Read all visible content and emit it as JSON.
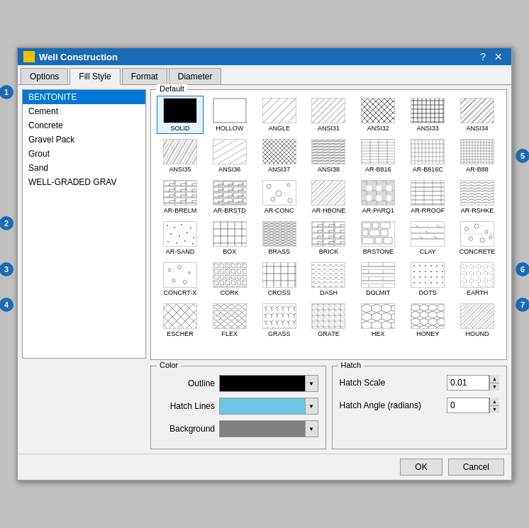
{
  "dialog": {
    "title": "Well Construction",
    "help_label": "?",
    "close_label": "✕"
  },
  "tabs": [
    {
      "label": "Options",
      "active": false
    },
    {
      "label": "Fill Style",
      "active": true
    },
    {
      "label": "Format",
      "active": false
    },
    {
      "label": "Diameter",
      "active": false
    }
  ],
  "materials": [
    {
      "label": "BENTONITE",
      "selected": true
    },
    {
      "label": "Cement",
      "selected": false
    },
    {
      "label": "Concrete",
      "selected": false
    },
    {
      "label": "Gravel Pack",
      "selected": false
    },
    {
      "label": "Grout",
      "selected": false
    },
    {
      "label": "Sand",
      "selected": false
    },
    {
      "label": "WELL-GRADED GRAV",
      "selected": false
    }
  ],
  "pattern_group_label": "Default",
  "patterns": [
    {
      "name": "SOLID",
      "type": "solid"
    },
    {
      "name": "HOLLOW",
      "type": "hollow"
    },
    {
      "name": "ANGLE",
      "type": "angle"
    },
    {
      "name": "ANSI31",
      "type": "ansi31"
    },
    {
      "name": "ANSI32",
      "type": "ansi32"
    },
    {
      "name": "ANSI33",
      "type": "ansi33"
    },
    {
      "name": "ANSI34",
      "type": "ansi34"
    },
    {
      "name": "ANSI35",
      "type": "ansi35"
    },
    {
      "name": "ANSI36",
      "type": "ansi36"
    },
    {
      "name": "ANSI37",
      "type": "ansi37"
    },
    {
      "name": "ANSI38",
      "type": "ansi38"
    },
    {
      "name": "AR-B816",
      "type": "ar-b816"
    },
    {
      "name": "AR-B816C",
      "type": "ar-b816c"
    },
    {
      "name": "AR-B88",
      "type": "ar-b88"
    },
    {
      "name": "AR-BRELM",
      "type": "ar-brelm"
    },
    {
      "name": "AR-BRSTD",
      "type": "ar-brstd"
    },
    {
      "name": "AR-CONC",
      "type": "ar-conc"
    },
    {
      "name": "AR-HBONE",
      "type": "ar-hbone"
    },
    {
      "name": "AR-PARQ1",
      "type": "ar-parq1"
    },
    {
      "name": "AR-RROOF",
      "type": "ar-rroof"
    },
    {
      "name": "AR-RSHKE",
      "type": "ar-rshke"
    },
    {
      "name": "AR-SAND",
      "type": "ar-sand"
    },
    {
      "name": "BOX",
      "type": "box"
    },
    {
      "name": "BRASS",
      "type": "brass"
    },
    {
      "name": "BRICK",
      "type": "brick"
    },
    {
      "name": "BRSTONE",
      "type": "brstone"
    },
    {
      "name": "CLAY",
      "type": "clay"
    },
    {
      "name": "CONCRETE",
      "type": "concrete"
    },
    {
      "name": "CONCRT-X",
      "type": "concrt-x"
    },
    {
      "name": "CORK",
      "type": "cork"
    },
    {
      "name": "CROSS",
      "type": "cross"
    },
    {
      "name": "DASH",
      "type": "dash"
    },
    {
      "name": "DOLMIT",
      "type": "dolmit"
    },
    {
      "name": "DOTS",
      "type": "dots"
    },
    {
      "name": "EARTH",
      "type": "earth"
    },
    {
      "name": "ESCHER",
      "type": "escher"
    },
    {
      "name": "FLEX",
      "type": "flex"
    },
    {
      "name": "GRASS",
      "type": "grass"
    },
    {
      "name": "GRATE",
      "type": "grate"
    },
    {
      "name": "HEX",
      "type": "hex"
    },
    {
      "name": "HONEY",
      "type": "honey"
    },
    {
      "name": "HOUND",
      "type": "hound"
    }
  ],
  "color_section_label": "Color",
  "color_rows": [
    {
      "label": "Outline",
      "color": "#000000"
    },
    {
      "label": "Hatch Lines",
      "color": "#6ec6e6"
    },
    {
      "label": "Background",
      "color": "#808080"
    }
  ],
  "hatch_section_label": "Hatch",
  "hatch_scale_label": "Hatch Scale",
  "hatch_scale_value": "0.01",
  "hatch_angle_label": "Hatch Angle (radians)",
  "hatch_angle_value": "0",
  "footer": {
    "ok_label": "OK",
    "cancel_label": "Cancel"
  },
  "callouts": [
    "1",
    "2",
    "3",
    "4",
    "5",
    "6",
    "7"
  ]
}
